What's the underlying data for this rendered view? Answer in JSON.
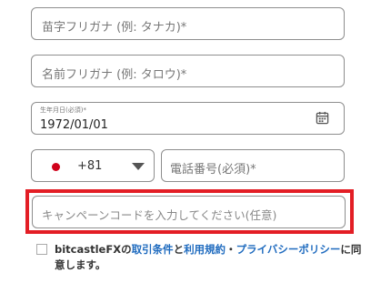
{
  "form": {
    "kana_sei_placeholder": "苗字フリガナ (例: タナカ)*",
    "kana_mei_placeholder": "名前フリガナ (例: タロウ)*",
    "birth_label": "生年月日(必須)*",
    "birth_value": "1972/01/01",
    "country_code": "+81",
    "phone_placeholder": "電話番号(必須)*",
    "campaign_placeholder": "キャンペーンコードを入力してください(任意)"
  },
  "agreement": {
    "brand": "bitcastleFX",
    "text_no": "の",
    "link_terms": "取引条件",
    "text_and": "と",
    "link_usage": "利用規約",
    "text_dot": "・",
    "link_privacy": "プライバシーポリシー",
    "text_end": "に同意します。"
  },
  "icons": {
    "calendar": "calendar-icon",
    "flag": "japan-flag-icon",
    "dropdown": "chevron-down-icon"
  },
  "colors": {
    "highlight": "#e31e25",
    "link": "#1f6bbf",
    "flag_red": "#d0021b"
  }
}
